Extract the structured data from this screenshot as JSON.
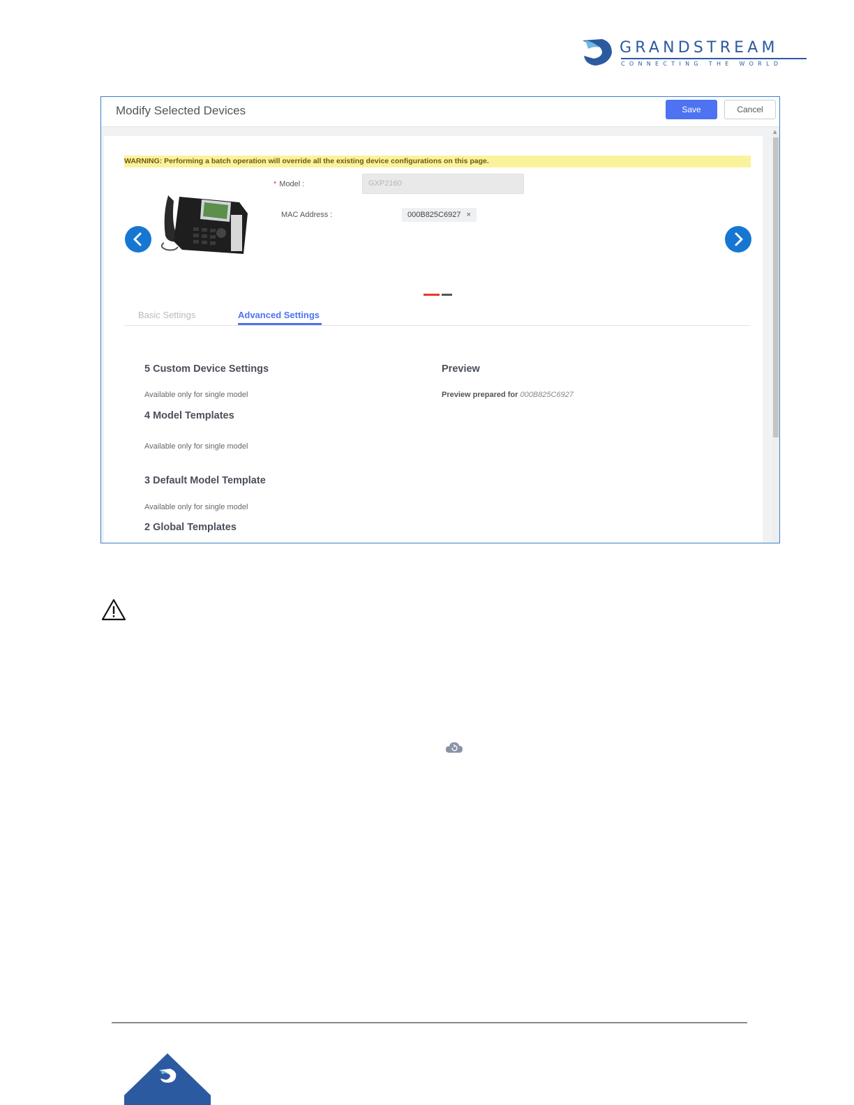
{
  "brand": {
    "name": "GRANDSTREAM",
    "tagline": "CONNECTING THE WORLD",
    "color": "#2c5aa0"
  },
  "dialog": {
    "title": "Modify Selected Devices",
    "save_label": "Save",
    "cancel_label": "Cancel",
    "warning": "WARNING: Performing a batch operation will override all the existing device configurations on this page.",
    "model": {
      "label": "Model :",
      "value": "GXP2160"
    },
    "mac": {
      "label": "MAC Address :",
      "value": "000B825C6927",
      "remove_icon": "×"
    },
    "carousel": {
      "prev_icon": "chevron-left-icon",
      "next_icon": "chevron-right-icon"
    },
    "tabs": [
      {
        "label": "Basic Settings",
        "active": false
      },
      {
        "label": "Advanced Settings",
        "active": true
      }
    ],
    "sections": [
      {
        "title": "5 Custom Device Settings",
        "note": "Available only for single model"
      },
      {
        "title": "4 Model Templates",
        "note": "Available only for single model"
      },
      {
        "title": "3 Default Model Template",
        "note": "Available only for single model"
      },
      {
        "title": "2 Global Templates"
      }
    ],
    "preview": {
      "title": "Preview",
      "prepared_label": "Preview prepared for",
      "prepared_value": "000B825C6927"
    }
  },
  "colors": {
    "accent": "#4d73f2",
    "nav": "#1677d2",
    "warning_bg": "#fbf39b",
    "dialog_border": "#3d7cc9"
  },
  "icons": {
    "caution": "warning-triangle-icon",
    "cloud": "cloud-sync-icon"
  }
}
